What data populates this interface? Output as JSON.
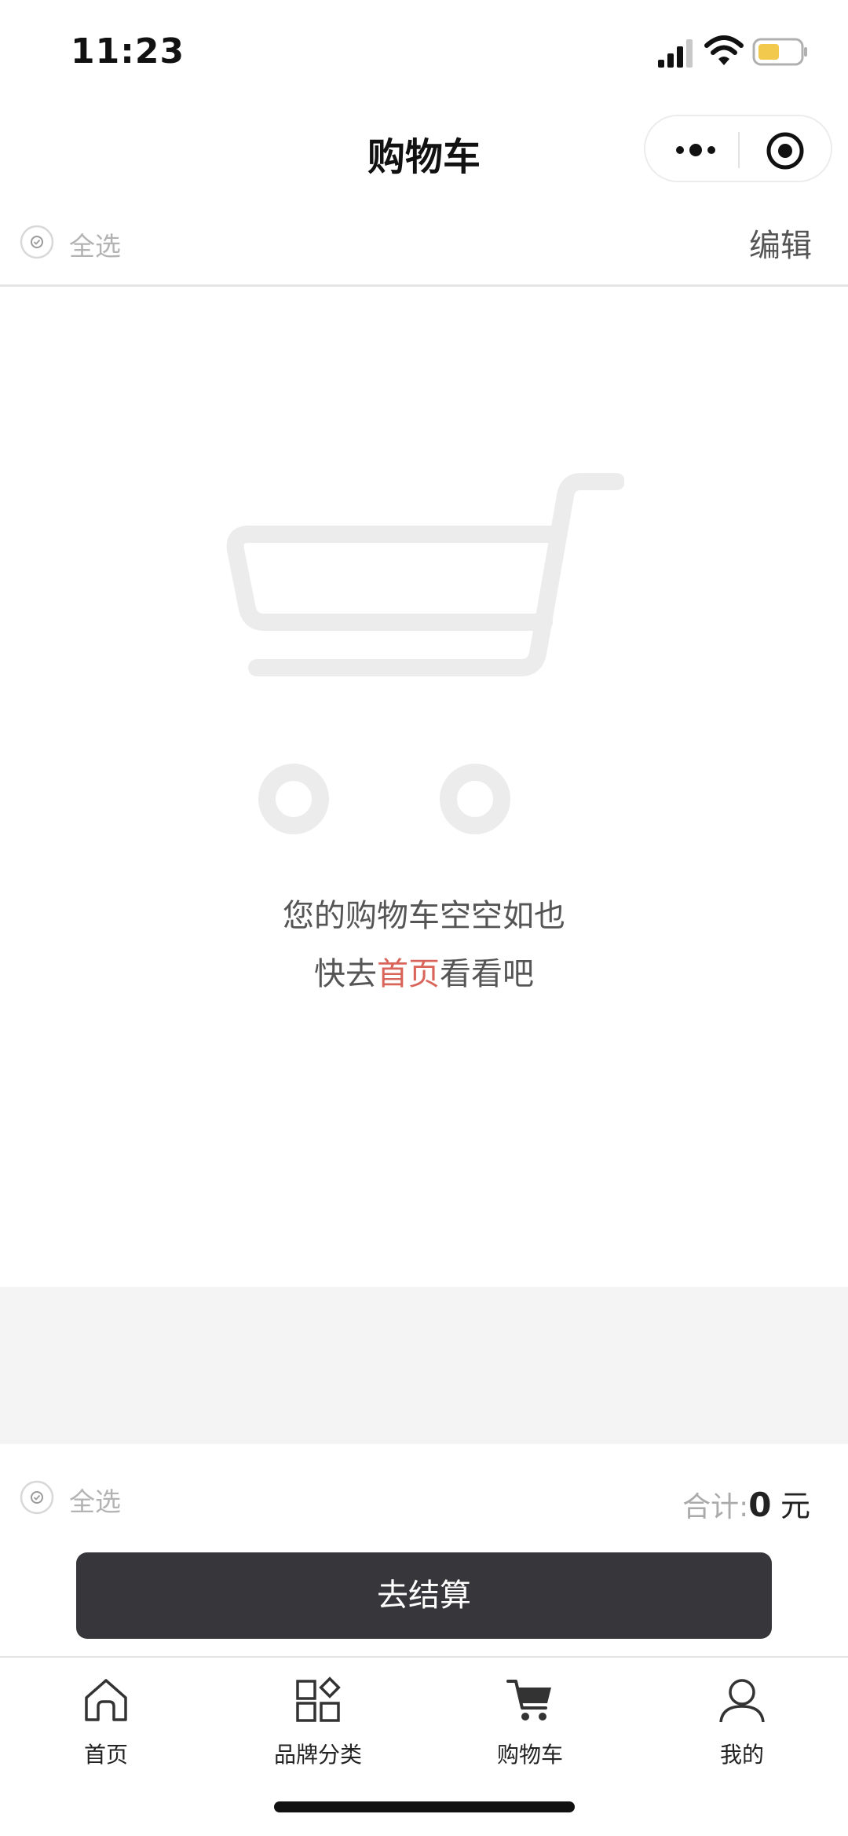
{
  "status_bar": {
    "time": "11:23",
    "battery_color": "#f2c94c"
  },
  "nav": {
    "title": "购物车"
  },
  "select_bar_top": {
    "select_all_label": "全选",
    "edit_label": "编辑"
  },
  "empty_state": {
    "line1": "您的购物车空空如也",
    "line2_prefix": "快去",
    "line2_link": "首页",
    "line2_suffix": "看看吧",
    "link_color": "#d9655a"
  },
  "summary": {
    "select_all_label": "全选",
    "total_label": "合计:",
    "total_amount": "0",
    "total_unit": "元",
    "checkout_label": "去结算"
  },
  "tabs": [
    {
      "label": "首页",
      "icon": "home-icon"
    },
    {
      "label": "品牌分类",
      "icon": "category-icon"
    },
    {
      "label": "购物车",
      "icon": "cart-icon",
      "active": true
    },
    {
      "label": "我的",
      "icon": "user-icon"
    }
  ],
  "colors": {
    "checkout_bg": "#36363b",
    "grey_band": "#f4f4f4"
  }
}
